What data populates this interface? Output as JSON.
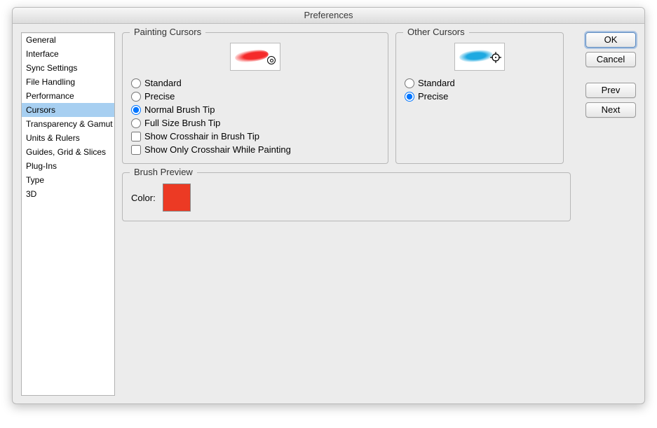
{
  "window": {
    "title": "Preferences"
  },
  "sidebar": {
    "items": [
      {
        "label": "General",
        "selected": false
      },
      {
        "label": "Interface",
        "selected": false
      },
      {
        "label": "Sync Settings",
        "selected": false
      },
      {
        "label": "File Handling",
        "selected": false
      },
      {
        "label": "Performance",
        "selected": false
      },
      {
        "label": "Cursors",
        "selected": true
      },
      {
        "label": "Transparency & Gamut",
        "selected": false
      },
      {
        "label": "Units & Rulers",
        "selected": false
      },
      {
        "label": "Guides, Grid & Slices",
        "selected": false
      },
      {
        "label": "Plug-Ins",
        "selected": false
      },
      {
        "label": "Type",
        "selected": false
      },
      {
        "label": "3D",
        "selected": false
      }
    ]
  },
  "painting_cursors": {
    "legend": "Painting Cursors",
    "options": {
      "standard": "Standard",
      "precise": "Precise",
      "normal_brush_tip": "Normal Brush Tip",
      "full_size_brush_tip": "Full Size Brush Tip",
      "show_crosshair": "Show Crosshair in Brush Tip",
      "show_only_crosshair": "Show Only Crosshair While Painting"
    },
    "selected": "normal_brush_tip",
    "show_crosshair_checked": false,
    "show_only_crosshair_checked": false
  },
  "other_cursors": {
    "legend": "Other Cursors",
    "options": {
      "standard": "Standard",
      "precise": "Precise"
    },
    "selected": "precise"
  },
  "brush_preview": {
    "legend": "Brush Preview",
    "color_label": "Color:",
    "color_value": "#ec3a24"
  },
  "buttons": {
    "ok": "OK",
    "cancel": "Cancel",
    "prev": "Prev",
    "next": "Next"
  }
}
